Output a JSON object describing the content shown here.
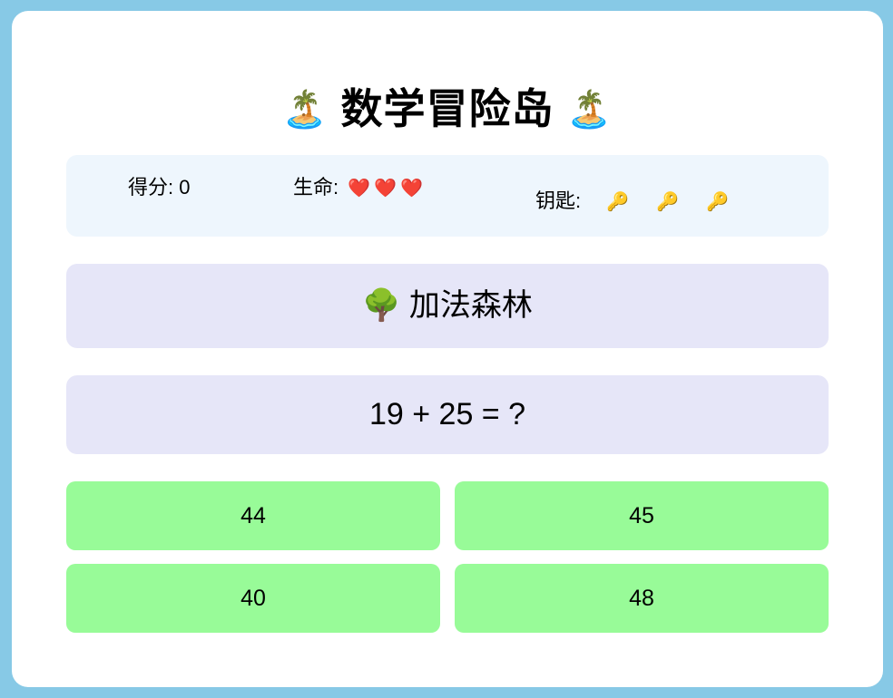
{
  "title": {
    "icon_left": "🏝️",
    "text": "数学冒险岛",
    "icon_right": "🏝️"
  },
  "stats": {
    "score_label": "得分: 0",
    "lives_label": "生命:",
    "lives_icons": [
      "❤️",
      "❤️",
      "❤️"
    ],
    "keys_label": "钥匙:",
    "keys_icons": [
      "🔑",
      "🔑",
      "🔑"
    ]
  },
  "level": {
    "icon": "🌳",
    "name": "加法森林"
  },
  "question": {
    "text": "19 + 25 = ?"
  },
  "answers": [
    "44",
    "45",
    "40",
    "48"
  ],
  "colors": {
    "background": "#87c9e6",
    "card": "#ffffff",
    "stats_panel": "#eef6fd",
    "level_panel": "#e6e6f8",
    "answer_button": "#98fb98"
  }
}
